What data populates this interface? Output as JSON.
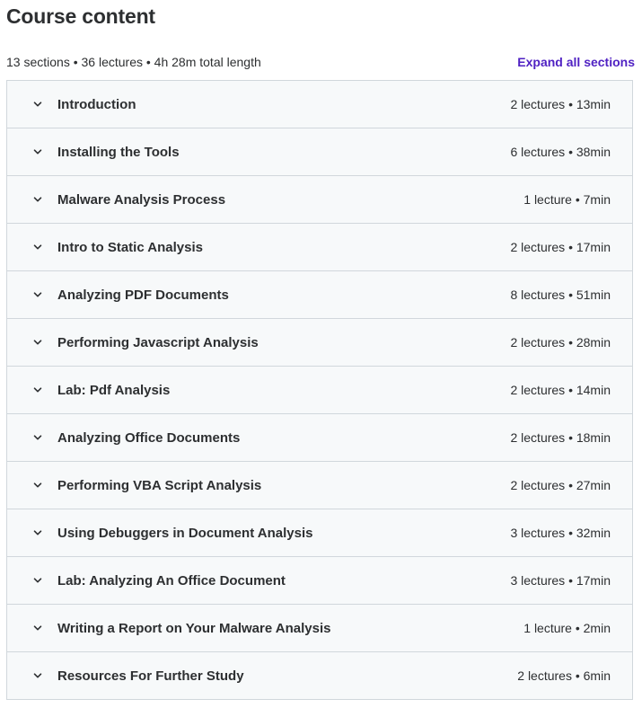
{
  "header": {
    "title": "Course content",
    "summary": "13 sections • 36 lectures • 4h 28m total length",
    "expand_label": "Expand all sections"
  },
  "icons": {
    "chevron": "chevron-down-icon"
  },
  "colors": {
    "accent": "#5022c3",
    "section_bg": "#f7f9fa",
    "border": "#d1d7dc",
    "text": "#2d2f31"
  },
  "sections": [
    {
      "title": "Introduction",
      "meta": "2 lectures • 13min"
    },
    {
      "title": "Installing the Tools",
      "meta": "6 lectures • 38min"
    },
    {
      "title": "Malware Analysis Process",
      "meta": "1 lecture • 7min"
    },
    {
      "title": "Intro to Static Analysis",
      "meta": "2 lectures • 17min"
    },
    {
      "title": "Analyzing PDF Documents",
      "meta": "8 lectures • 51min"
    },
    {
      "title": "Performing Javascript Analysis",
      "meta": "2 lectures • 28min"
    },
    {
      "title": "Lab: Pdf Analysis",
      "meta": "2 lectures • 14min"
    },
    {
      "title": "Analyzing Office Documents",
      "meta": "2 lectures • 18min"
    },
    {
      "title": "Performing VBA Script Analysis",
      "meta": "2 lectures • 27min"
    },
    {
      "title": "Using Debuggers in Document Analysis",
      "meta": "3 lectures • 32min"
    },
    {
      "title": "Lab: Analyzing An Office Document",
      "meta": "3 lectures • 17min"
    },
    {
      "title": "Writing a Report on Your Malware Analysis",
      "meta": "1 lecture • 2min"
    },
    {
      "title": "Resources For Further Study",
      "meta": "2 lectures • 6min"
    }
  ]
}
